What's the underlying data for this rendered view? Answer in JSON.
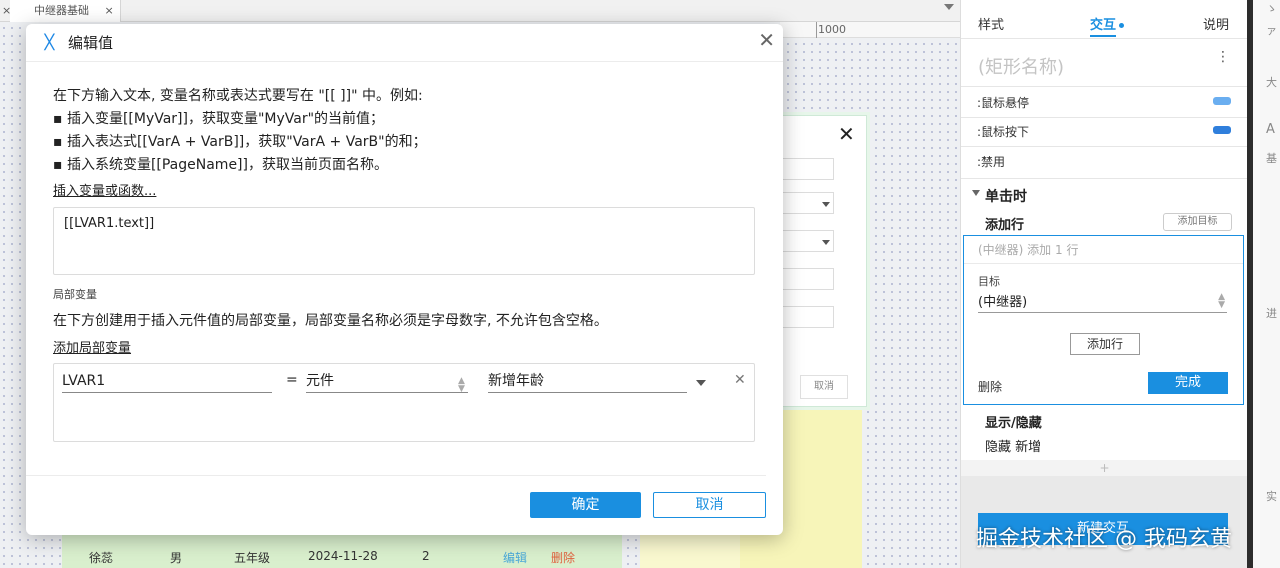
{
  "tabs": {
    "active_label": "中继器基础",
    "close_glyph": "×"
  },
  "ruler": {
    "mark": "1000"
  },
  "background_row": {
    "name": "徐蕊",
    "gender": "男",
    "grade": "五年级",
    "date": "2024-11-28",
    "count": "2",
    "edit": "编辑",
    "delete": "删除"
  },
  "background_card": {
    "close": "✕",
    "cancel": "取消"
  },
  "dialog": {
    "icon": "ᚷ",
    "title": "编辑值",
    "close": "✕",
    "instructions": [
      "在下方输入文本, 变量名称或表达式要写在 \"[[ ]]\" 中。例如:",
      "▪ 插入变量[[MyVar]]，获取变量\"MyVar\"的当前值；",
      "▪ 插入表达式[[VarA + VarB]]，获取\"VarA + VarB\"的和；",
      "▪ 插入系统变量[[PageName]]，获取当前页面名称。"
    ],
    "insert_link": "插入变量或函数...",
    "text_value": "[[LVAR1.text]]",
    "local_vars_label": "局部变量",
    "local_vars_desc": "在下方创建用于插入元件值的局部变量，局部变量名称必须是字母数字, 不允许包含空格。",
    "add_local_var": "添加局部变量",
    "var_row": {
      "name": "LVAR1",
      "equals": "=",
      "type": "元件",
      "target": "新增年龄",
      "remove": "✕"
    },
    "ok": "确定",
    "cancel": "取消"
  },
  "panel": {
    "tabs": [
      "样式",
      "交互",
      "说明"
    ],
    "shape_name": "(矩形名称)",
    "kebab": "⋮",
    "states": [
      {
        "label": ":鼠标悬停",
        "color": "#6aaef0"
      },
      {
        "label": ":鼠标按下",
        "color": "#2f7fdc"
      },
      {
        "label": ":禁用",
        "color": ""
      }
    ],
    "event": "单击时",
    "action_title": "添加行",
    "add_target": "添加目标",
    "action_summary": "(中继器) 添加 1 行",
    "target_label": "目标",
    "target_value": "(中继器)",
    "add_row_button": "添加行",
    "delete": "删除",
    "done": "完成",
    "show_hide_title": "显示/隐藏",
    "show_hide_detail": "隐藏 新增",
    "plus": "+",
    "new_interaction": "新建交互"
  },
  "watermark": "掘金技术社区 @ 我码玄黄",
  "far_right": [
    "ゝ",
    "ァ",
    "大",
    "A",
    "基",
    "进",
    "实"
  ]
}
